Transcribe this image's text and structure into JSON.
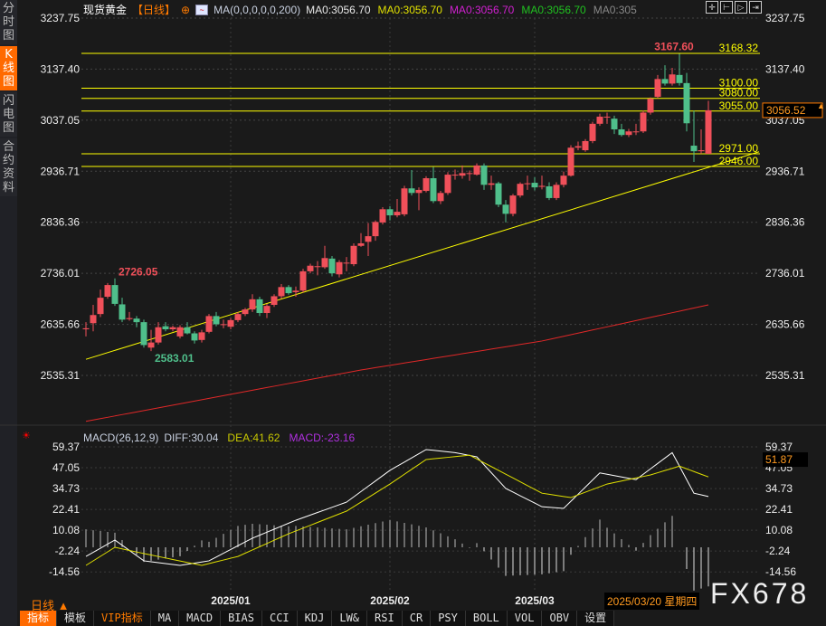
{
  "sidebar": {
    "items": [
      {
        "label": "分时图",
        "active": false
      },
      {
        "label": "K线图",
        "active": true
      },
      {
        "label": "闪电图",
        "active": false
      },
      {
        "label": "合约资料",
        "active": false
      }
    ]
  },
  "legend": {
    "symbol": "现货黄金",
    "period": "【日线】",
    "ma_params": "MA(0,0,0,0,0,200)",
    "ma_values": [
      {
        "text": "MA0:3056.70",
        "color": "#e8e8e8"
      },
      {
        "text": "MA0:3056.70",
        "color": "#e0e000"
      },
      {
        "text": "MA0:3056.70",
        "color": "#d020d0"
      },
      {
        "text": "MA0:3056.70",
        "color": "#20c020"
      },
      {
        "text": "MA0:305",
        "color": "#888888"
      }
    ]
  },
  "top_icons": [
    "crosshair-icon",
    "zoom-in-icon",
    "zoom-out-icon",
    "move-right-icon"
  ],
  "macd_legend": {
    "name": "MACD(26,12,9)",
    "diff": "DIFF:30.04",
    "dea": "DEA:41.62",
    "macd": "MACD:-23.16"
  },
  "period_label": "日线 ▲",
  "crosshair_date": "2025/03/20 星期四",
  "watermark": "FX678",
  "toolbar": [
    {
      "label": "指标",
      "active": true
    },
    {
      "label": "模板"
    },
    {
      "label": "VIP指标",
      "vip": true
    },
    {
      "label": "MA"
    },
    {
      "label": "MACD"
    },
    {
      "label": "BIAS"
    },
    {
      "label": "CCI"
    },
    {
      "label": "KDJ"
    },
    {
      "label": "LW&"
    },
    {
      "label": "RSI"
    },
    {
      "label": "CR"
    },
    {
      "label": "PSY"
    },
    {
      "label": "BOLL"
    },
    {
      "label": "VOL"
    },
    {
      "label": "OBV"
    },
    {
      "label": "设置"
    }
  ],
  "colors": {
    "up": "#f0505a",
    "down": "#4fbf8b",
    "lines": "#ffff00",
    "ma200": "#e02828",
    "diff": "#ffffff",
    "dea": "#e0e000",
    "accent": "#ff6a00"
  },
  "chart_data": [
    {
      "type": "candlestick",
      "title": "现货黄金 日线",
      "x_ticks": [
        {
          "index": 20,
          "label": "2025/01"
        },
        {
          "index": 42,
          "label": "2025/02"
        },
        {
          "index": 62,
          "label": "2025/03"
        }
      ],
      "y_ticks": [
        "3237.75",
        "3137.40",
        "3037.05",
        "2936.71",
        "2836.36",
        "2736.01",
        "2635.66",
        "2535.31"
      ],
      "ylim": [
        2420,
        3237.75
      ],
      "current_price": "3056.52",
      "annotations": [
        {
          "index": 4,
          "value": 2726.05,
          "label": "2726.05",
          "color": "#f0505a"
        },
        {
          "index": 9,
          "value": 2583.01,
          "label": "2583.01",
          "color": "#4fbf8b"
        },
        {
          "index": 82,
          "value": 3167.6,
          "label": "3167.60",
          "color": "#f0505a"
        }
      ],
      "horizontal_lines": [
        {
          "value": 3168.32,
          "label": "3168.32"
        },
        {
          "value": 3100,
          "label": "3100.00"
        },
        {
          "value": 3080,
          "label": "3080.00"
        },
        {
          "value": 3055,
          "label": "3055.00"
        },
        {
          "value": 2971,
          "label": "2971.00"
        },
        {
          "value": 2946,
          "label": "2946.00"
        }
      ],
      "trendline": [
        [
          0,
          2567
        ],
        [
          93,
          2975
        ]
      ],
      "ma200": [
        [
          0,
          2445
        ],
        [
          38,
          2546
        ],
        [
          63,
          2603
        ],
        [
          86,
          2674
        ]
      ],
      "ohlc": [
        [
          2626,
          2640,
          2612,
          2628
        ],
        [
          2638,
          2674,
          2622,
          2654
        ],
        [
          2656,
          2704,
          2650,
          2688
        ],
        [
          2690,
          2717,
          2686,
          2713
        ],
        [
          2713,
          2726.05,
          2672,
          2676
        ],
        [
          2675,
          2688,
          2640,
          2645
        ],
        [
          2646,
          2660,
          2643,
          2648
        ],
        [
          2647,
          2652,
          2630,
          2640
        ],
        [
          2640,
          2645,
          2590,
          2595
        ],
        [
          2590,
          2625,
          2583.01,
          2600
        ],
        [
          2600,
          2640,
          2596,
          2630
        ],
        [
          2632,
          2640,
          2622,
          2626
        ],
        [
          2626,
          2633,
          2622,
          2630
        ],
        [
          2612,
          2634,
          2608,
          2630
        ],
        [
          2630,
          2640,
          2616,
          2618
        ],
        [
          2618,
          2622,
          2598,
          2604
        ],
        [
          2605,
          2625,
          2600,
          2620
        ],
        [
          2621,
          2656,
          2618,
          2652
        ],
        [
          2652,
          2660,
          2632,
          2636
        ],
        [
          2636,
          2645,
          2628,
          2636
        ],
        [
          2631,
          2648,
          2626,
          2644
        ],
        [
          2644,
          2660,
          2640,
          2656
        ],
        [
          2656,
          2668,
          2652,
          2665
        ],
        [
          2665,
          2695,
          2660,
          2685
        ],
        [
          2685,
          2690,
          2652,
          2658
        ],
        [
          2658,
          2676,
          2648,
          2672
        ],
        [
          2674,
          2695,
          2670,
          2691
        ],
        [
          2691,
          2715,
          2686,
          2709
        ],
        [
          2709,
          2713,
          2694,
          2697
        ],
        [
          2699,
          2710,
          2690,
          2702
        ],
        [
          2702,
          2745,
          2698,
          2740
        ],
        [
          2740,
          2755,
          2736,
          2751
        ],
        [
          2750,
          2760,
          2732,
          2750
        ],
        [
          2748,
          2790,
          2745,
          2766
        ],
        [
          2765,
          2770,
          2730,
          2736
        ],
        [
          2734,
          2762,
          2728,
          2758
        ],
        [
          2757,
          2768,
          2740,
          2757
        ],
        [
          2754,
          2795,
          2750,
          2790
        ],
        [
          2790,
          2815,
          2788,
          2795
        ],
        [
          2798,
          2835,
          2770,
          2809
        ],
        [
          2809,
          2840,
          2800,
          2837
        ],
        [
          2836,
          2866,
          2832,
          2862
        ],
        [
          2862,
          2868,
          2840,
          2850
        ],
        [
          2850,
          2882,
          2846,
          2857
        ],
        [
          2852,
          2908,
          2848,
          2903
        ],
        [
          2903,
          2939,
          2889,
          2894
        ],
        [
          2894,
          2905,
          2860,
          2900
        ],
        [
          2898,
          2927,
          2895,
          2923
        ],
        [
          2923,
          2945,
          2874,
          2878
        ],
        [
          2878,
          2898,
          2872,
          2894
        ],
        [
          2894,
          2935,
          2890,
          2930
        ],
        [
          2930,
          2940,
          2920,
          2930
        ],
        [
          2928,
          2948,
          2922,
          2933
        ],
        [
          2933,
          2938,
          2918,
          2933
        ],
        [
          2930,
          2952,
          2928,
          2948
        ],
        [
          2948,
          2952,
          2900,
          2910
        ],
        [
          2910,
          2928,
          2900,
          2913
        ],
        [
          2913,
          2916,
          2866,
          2871
        ],
        [
          2871,
          2880,
          2836,
          2853
        ],
        [
          2853,
          2892,
          2848,
          2889
        ],
        [
          2889,
          2915,
          2885,
          2912
        ],
        [
          2913,
          2928,
          2900,
          2913
        ],
        [
          2914,
          2925,
          2899,
          2905
        ],
        [
          2906,
          2928,
          2901,
          2908
        ],
        [
          2907,
          2915,
          2880,
          2884
        ],
        [
          2884,
          2915,
          2880,
          2910
        ],
        [
          2910,
          2936,
          2905,
          2928
        ],
        [
          2928,
          2988,
          2926,
          2983
        ],
        [
          2983,
          2995,
          2978,
          2986
        ],
        [
          2978,
          3000,
          2975,
          2996
        ],
        [
          2996,
          3034,
          2992,
          3030
        ],
        [
          3030,
          3050,
          3026,
          3044
        ],
        [
          3044,
          3052,
          3030,
          3044
        ],
        [
          3040,
          3046,
          3010,
          3019
        ],
        [
          3019,
          3030,
          3005,
          3008
        ],
        [
          3008,
          3020,
          3004,
          3015
        ],
        [
          3015,
          3030,
          3008,
          3015
        ],
        [
          3015,
          3056,
          3012,
          3052
        ],
        [
          3052,
          3082,
          3048,
          3079
        ],
        [
          3083,
          3126,
          3080,
          3118
        ],
        [
          3118,
          3145,
          3105,
          3109
        ],
        [
          3109,
          3140,
          3105,
          3127
        ],
        [
          3126,
          3167.6,
          3105,
          3110
        ],
        [
          3110,
          3130,
          3015,
          3031
        ],
        [
          2987,
          3056,
          2955,
          2976
        ],
        [
          2976,
          3019,
          2971,
          2978
        ],
        [
          2971,
          3075,
          2971,
          3056.52
        ]
      ]
    },
    {
      "type": "line+bar",
      "title": "MACD(26,12,9)",
      "y_ticks": [
        "59.37",
        "47.05",
        "34.73",
        "22.41",
        "10.08",
        "-2.24",
        "-14.56"
      ],
      "current_label": "51.87",
      "diff": [
        [
          0,
          -5.4
        ],
        [
          4,
          4.3
        ],
        [
          8,
          -8
        ],
        [
          13,
          -10.7
        ],
        [
          17,
          -8
        ],
        [
          23,
          5.4
        ],
        [
          29,
          16
        ],
        [
          36,
          26.7
        ],
        [
          42,
          45.5
        ],
        [
          47,
          57.8
        ],
        [
          51,
          56
        ],
        [
          54,
          53.5
        ],
        [
          58,
          34.8
        ],
        [
          63,
          24
        ],
        [
          66,
          23
        ],
        [
          71,
          44
        ],
        [
          76,
          40
        ],
        [
          81,
          56
        ],
        [
          84,
          32
        ],
        [
          86,
          30.04
        ]
      ],
      "dea": [
        [
          0,
          -10.7
        ],
        [
          4,
          0
        ],
        [
          8,
          -3.7
        ],
        [
          16,
          -10.7
        ],
        [
          21,
          -5.4
        ],
        [
          28,
          8
        ],
        [
          36,
          21.4
        ],
        [
          42,
          37.4
        ],
        [
          47,
          51.9
        ],
        [
          53,
          54.5
        ],
        [
          57,
          45.5
        ],
        [
          63,
          32
        ],
        [
          67,
          29.4
        ],
        [
          72,
          37.4
        ],
        [
          78,
          42.8
        ],
        [
          82,
          48
        ],
        [
          86,
          41.62
        ]
      ]
    }
  ]
}
